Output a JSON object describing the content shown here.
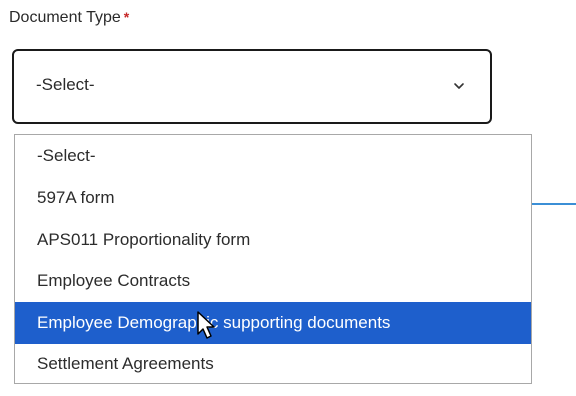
{
  "field": {
    "label": "Document Type",
    "required_marker": "*"
  },
  "select": {
    "value": "-Select-",
    "icon": "chevron-down-icon"
  },
  "dropdown": {
    "options": [
      "-Select-",
      "597A form",
      "APS011 Proportionality form",
      "Employee Contracts",
      "Employee Demographic supporting documents",
      "Settlement Agreements"
    ],
    "highlighted_option": "Employee Demographic supporting documents"
  },
  "colors": {
    "highlight": "#1e5fcc",
    "required": "#c62828",
    "accent_line": "#3b8fd6"
  },
  "cursor": {
    "icon": "mouse-pointer-icon"
  }
}
